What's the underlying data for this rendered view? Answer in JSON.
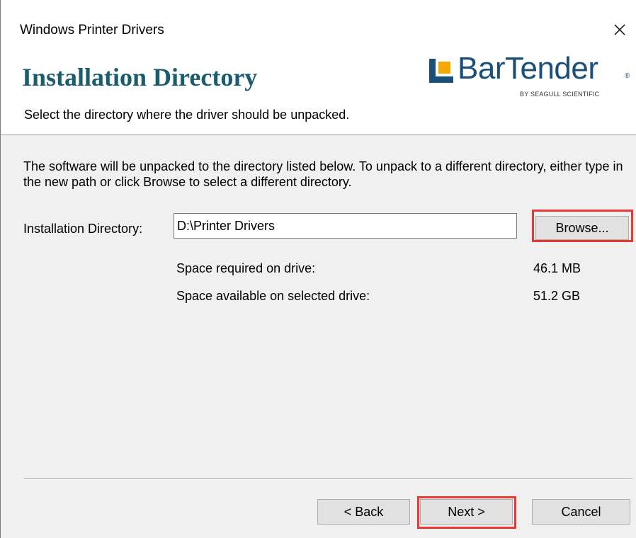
{
  "window": {
    "title": "Windows Printer Drivers",
    "close_glyph": "×"
  },
  "header": {
    "title": "Installation Directory",
    "subtitle": "Select the directory where the driver should be unpacked.",
    "logo": {
      "brand": "BarTender",
      "registered": "®",
      "tagline": "BY SEAGULL SCIENTIFIC"
    }
  },
  "body": {
    "description": "The software will be unpacked to the directory listed below.  To unpack to a different directory, either type in the new path or click Browse to select a different directory.",
    "directory_label": "Installation Directory:",
    "directory_value": "D:\\Printer Drivers",
    "browse_label": "Browse...",
    "space_required_label": "Space required on drive:",
    "space_required_value": "46.1 MB",
    "space_available_label": "Space available on selected drive:",
    "space_available_value": "51.2 GB"
  },
  "footer": {
    "back_label": "< Back",
    "next_label": "Next >",
    "cancel_label": "Cancel"
  },
  "colors": {
    "title_teal": "#1a5d6c",
    "logo_blue": "#1a4f7a",
    "highlight_red": "#e53935"
  },
  "icons": {
    "logo_mark": "bartender-logo-icon",
    "close": "close-icon"
  }
}
